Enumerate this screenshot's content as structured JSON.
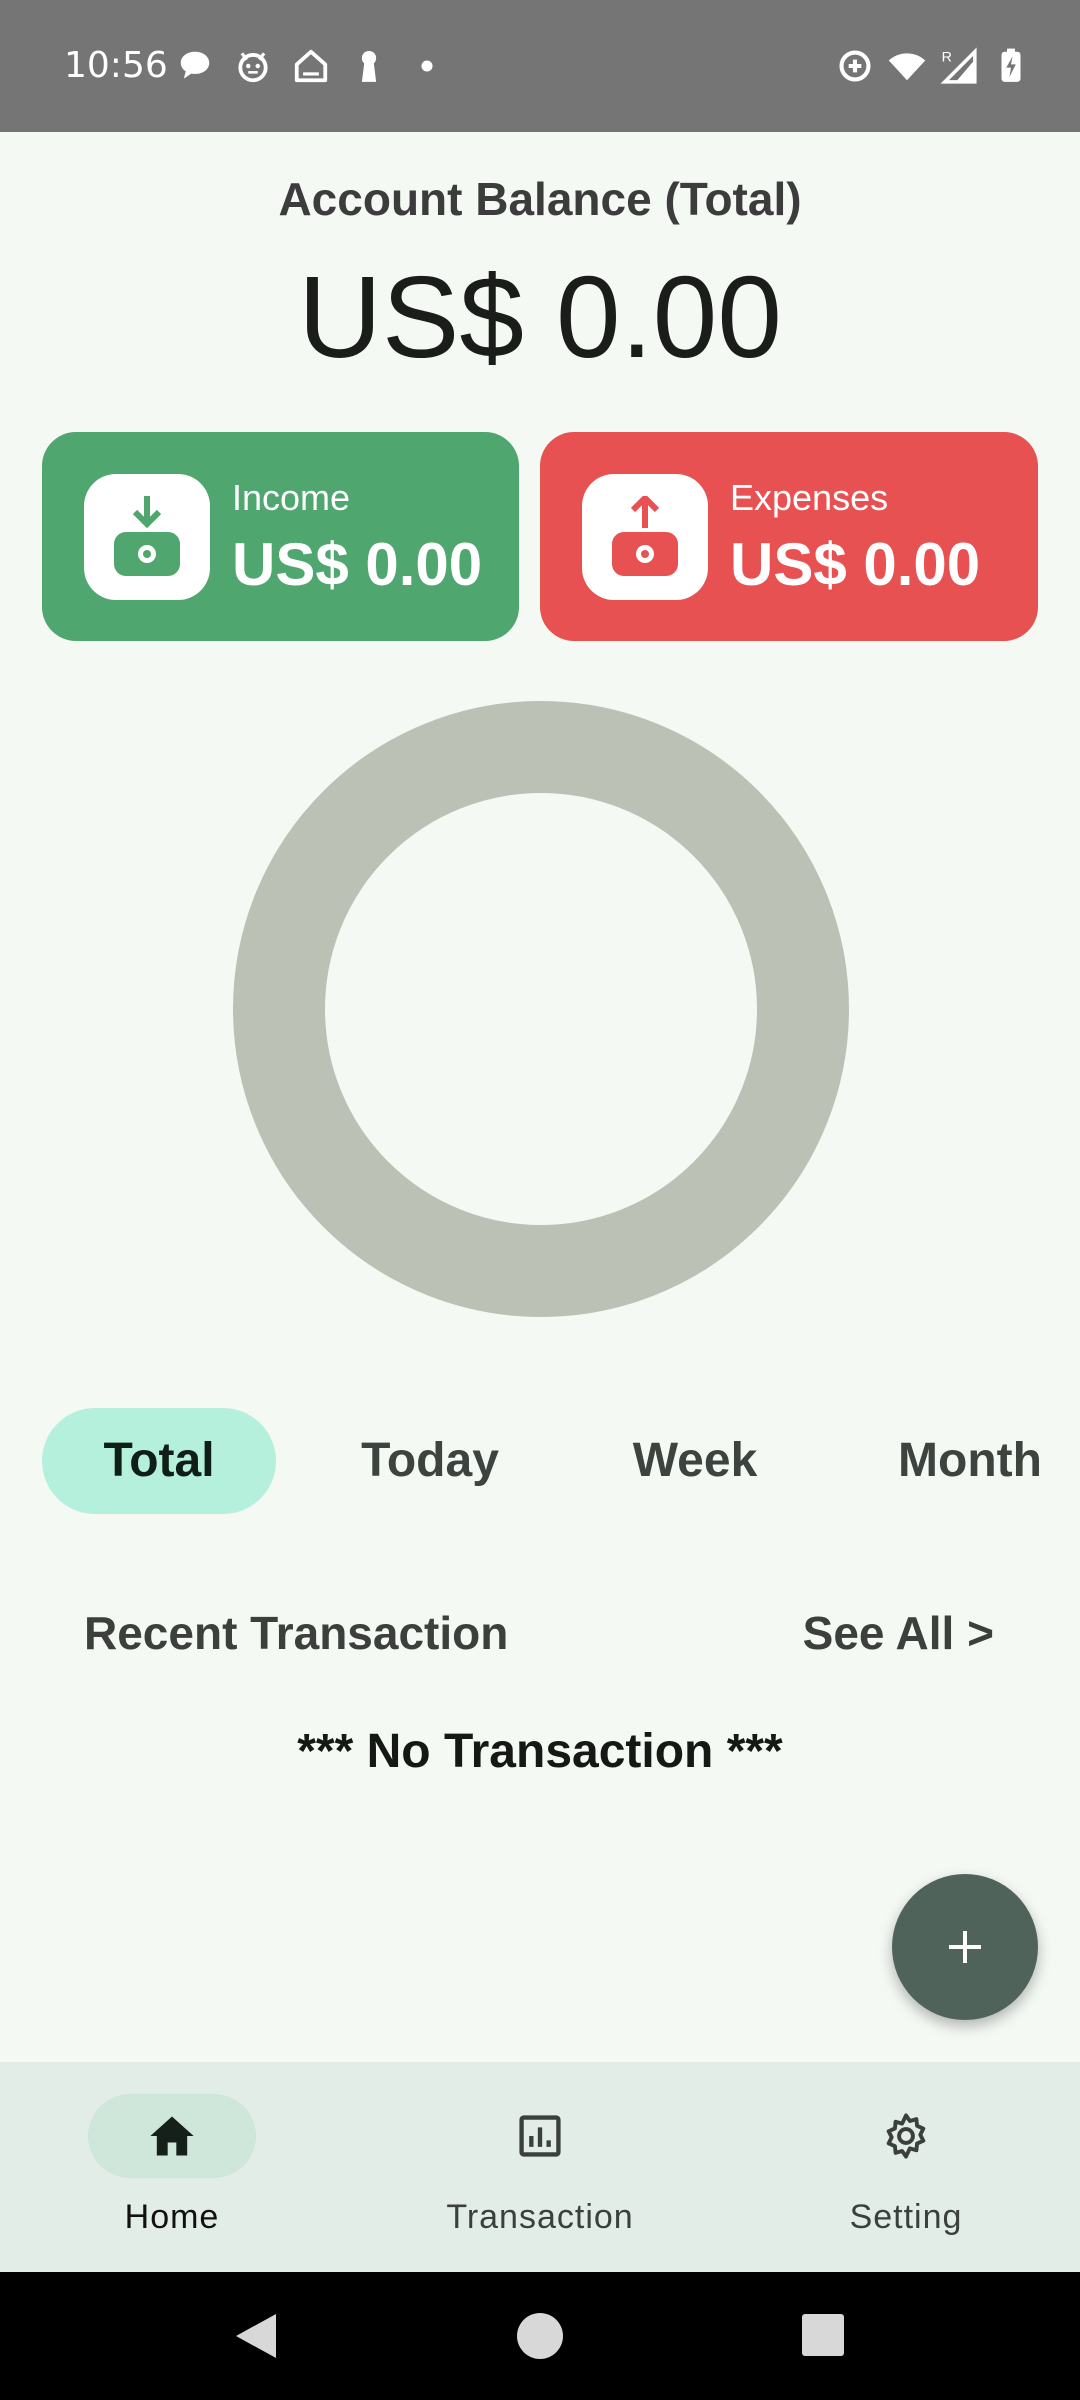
{
  "status_bar": {
    "time": "10:56",
    "left_icons": [
      "chat-bubble-icon",
      "cat-face-icon",
      "home-outline-icon",
      "keyhole-icon",
      "dot-icon"
    ],
    "right_icons": [
      "data-saver-icon",
      "wifi-icon",
      "signal-roaming-icon",
      "battery-charging-icon"
    ],
    "roaming_indicator": "R"
  },
  "balance": {
    "title": "Account Balance (Total)",
    "amount": "US$ 0.00"
  },
  "cards": {
    "income": {
      "label": "Income",
      "value": "US$ 0.00",
      "icon": "wallet-download-icon",
      "color": "#4fa66f"
    },
    "expenses": {
      "label": "Expenses",
      "value": "US$ 0.00",
      "icon": "wallet-upload-icon",
      "color": "#e85152"
    }
  },
  "chart_data": {
    "type": "pie",
    "categories": [],
    "values": [],
    "empty_ring_color": "#bbc2b5"
  },
  "period_tabs": {
    "selected": "Total",
    "items": [
      "Total",
      "Today",
      "Week",
      "Month"
    ]
  },
  "recent": {
    "title": "Recent Transaction",
    "see_all": "See All >",
    "empty_message": "*** No Transaction ***"
  },
  "fab": {
    "icon": "plus-icon"
  },
  "bottom_nav": {
    "items": [
      {
        "label": "Home",
        "icon": "home-icon",
        "active": true
      },
      {
        "label": "Transaction",
        "icon": "bar-chart-icon",
        "active": false
      },
      {
        "label": "Setting",
        "icon": "gear-icon",
        "active": false
      }
    ]
  },
  "system_nav": {
    "icons": [
      "back-icon",
      "home-circle-icon",
      "recents-icon"
    ]
  },
  "colors": {
    "background": "#f4f9f4",
    "active_tab": "#b5f0dc",
    "fab": "#4f635b",
    "nav_bar": "#e3ede8"
  }
}
